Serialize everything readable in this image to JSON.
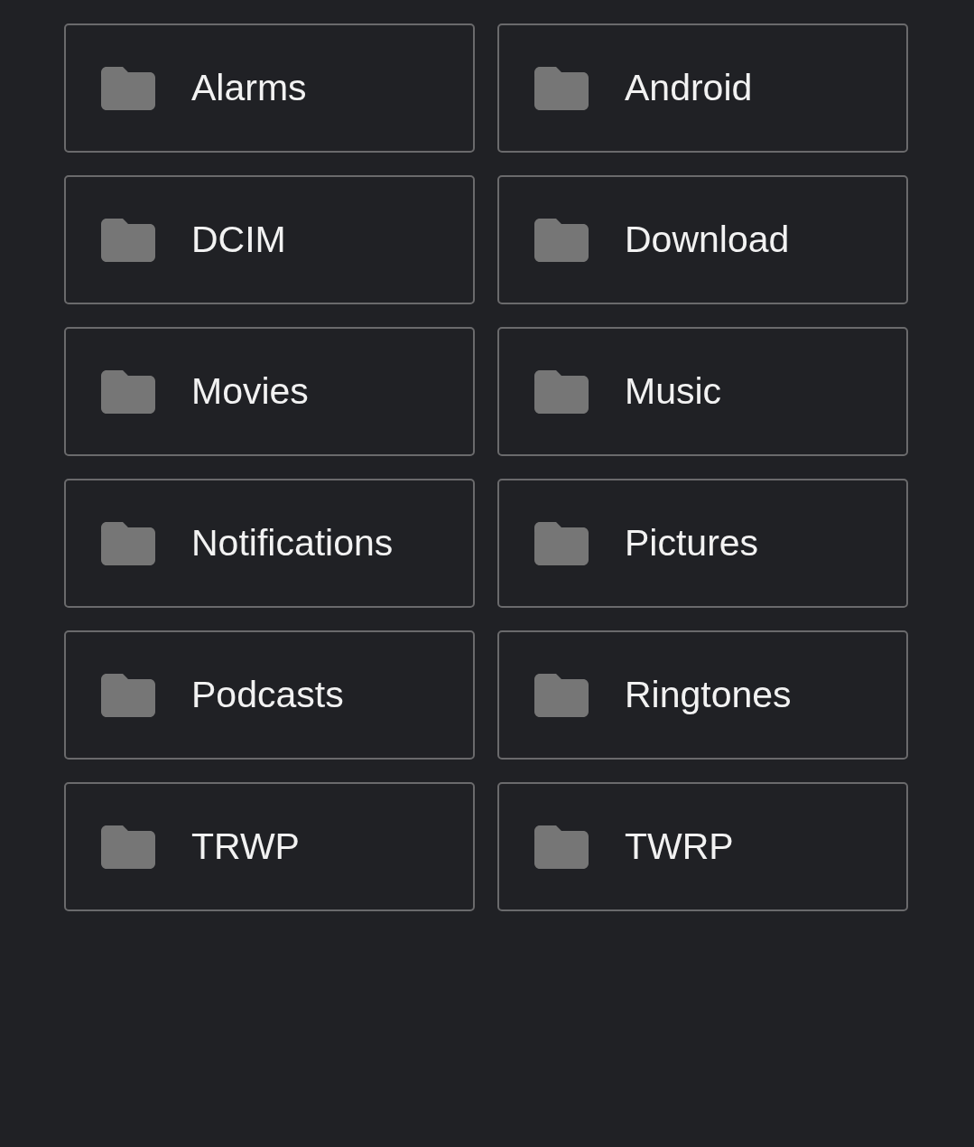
{
  "folders": [
    {
      "name": "Alarms"
    },
    {
      "name": "Android"
    },
    {
      "name": "DCIM"
    },
    {
      "name": "Download"
    },
    {
      "name": "Movies"
    },
    {
      "name": "Music"
    },
    {
      "name": "Notifications"
    },
    {
      "name": "Pictures"
    },
    {
      "name": "Podcasts"
    },
    {
      "name": "Ringtones"
    },
    {
      "name": "TRWP"
    },
    {
      "name": "TWRP"
    }
  ]
}
